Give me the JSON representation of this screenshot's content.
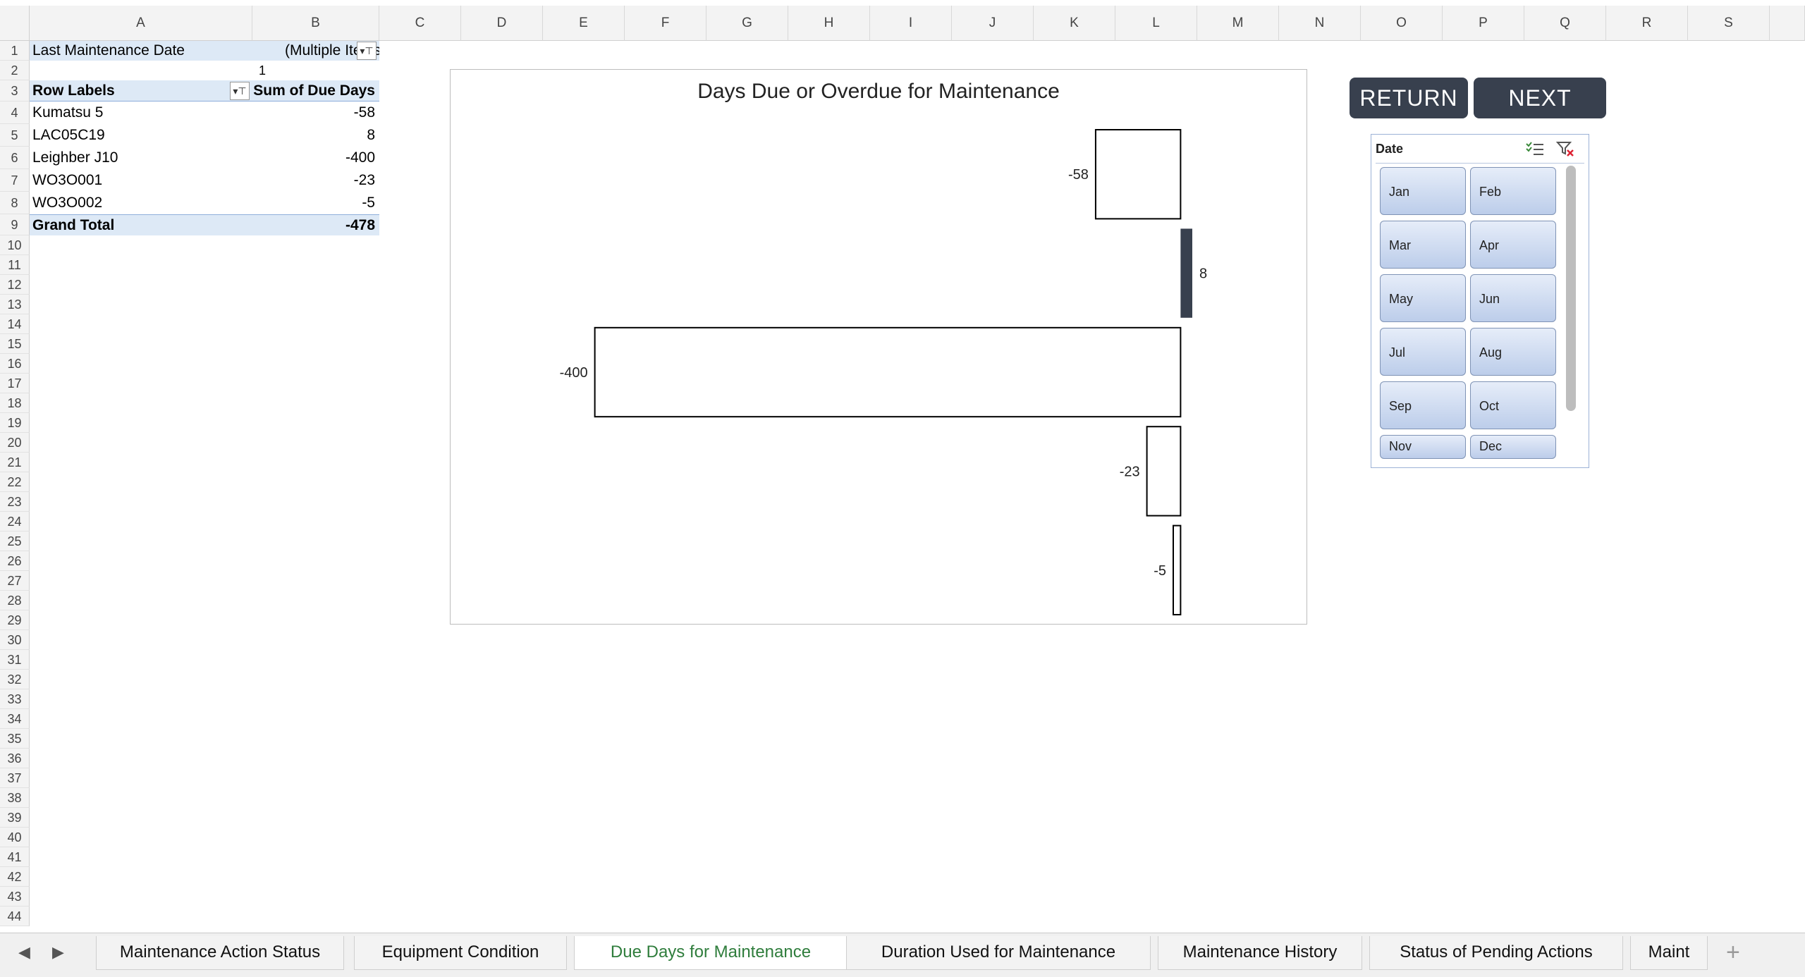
{
  "columns": [
    "A",
    "B",
    "C",
    "D",
    "E",
    "F",
    "G",
    "H",
    "I",
    "J",
    "K",
    "L",
    "M",
    "N",
    "O",
    "P",
    "Q",
    "R",
    "S"
  ],
  "rows": [
    "1",
    "2",
    "3",
    "4",
    "5",
    "6",
    "7",
    "8",
    "9",
    "10",
    "11",
    "12",
    "13",
    "14",
    "15",
    "16",
    "17",
    "18",
    "19",
    "20",
    "21",
    "22",
    "23",
    "24",
    "25",
    "26",
    "27",
    "28",
    "29",
    "30",
    "31",
    "32",
    "33",
    "34",
    "35",
    "36",
    "37",
    "38",
    "39",
    "40",
    "41",
    "42",
    "43",
    "44"
  ],
  "pivot": {
    "filter_label": "Last Maintenance Date",
    "filter_value": "(Multiple Items)",
    "row2_value": "1",
    "row_labels_header": "Row Labels",
    "value_header": "Sum of Due Days",
    "items": [
      {
        "label": "Kumatsu 5",
        "value": "-58"
      },
      {
        "label": "LAC05C19",
        "value": "8"
      },
      {
        "label": "Leighber J10",
        "value": "-400"
      },
      {
        "label": "WO3O001",
        "value": "-23"
      },
      {
        "label": "WO3O002",
        "value": "-5"
      }
    ],
    "total_label": "Grand Total",
    "total_value": "-478"
  },
  "chart_data": {
    "type": "bar",
    "orientation": "horizontal",
    "title": "Days Due or Overdue for Maintenance",
    "categories": [
      "Kumatsu 5",
      "LAC05C19",
      "Leighber J10",
      "WO3O001",
      "WO3O002"
    ],
    "values": [
      -58,
      8,
      -400,
      -23,
      -5
    ],
    "xlim": [
      -460,
      60
    ],
    "grid": false,
    "legend": "none",
    "colors": {
      "negative_fill": "#ffffff",
      "negative_stroke": "#000000",
      "positive_fill": "#38404e"
    }
  },
  "buttons": {
    "return_label": "RETURN",
    "next_label": "NEXT"
  },
  "slicer": {
    "title": "Date",
    "items": [
      "Jan",
      "Feb",
      "Mar",
      "Apr",
      "May",
      "Jun",
      "Jul",
      "Aug",
      "Sep",
      "Oct",
      "Nov",
      "Dec"
    ]
  },
  "tabs": [
    {
      "label": "Maintenance Action Status",
      "active": false
    },
    {
      "label": "Equipment Condition",
      "active": false
    },
    {
      "label": "Due Days for Maintenance",
      "active": true
    },
    {
      "label": "Duration Used for Maintenance",
      "active": false
    },
    {
      "label": "Maintenance History",
      "active": false
    },
    {
      "label": "Status of Pending Actions",
      "active": false
    },
    {
      "label": "Maint",
      "active": false
    }
  ],
  "colors": {
    "accent_tab": "#2f7d3c",
    "button_bg": "#38404e",
    "pivot_header_bg": "#dde9f6"
  }
}
